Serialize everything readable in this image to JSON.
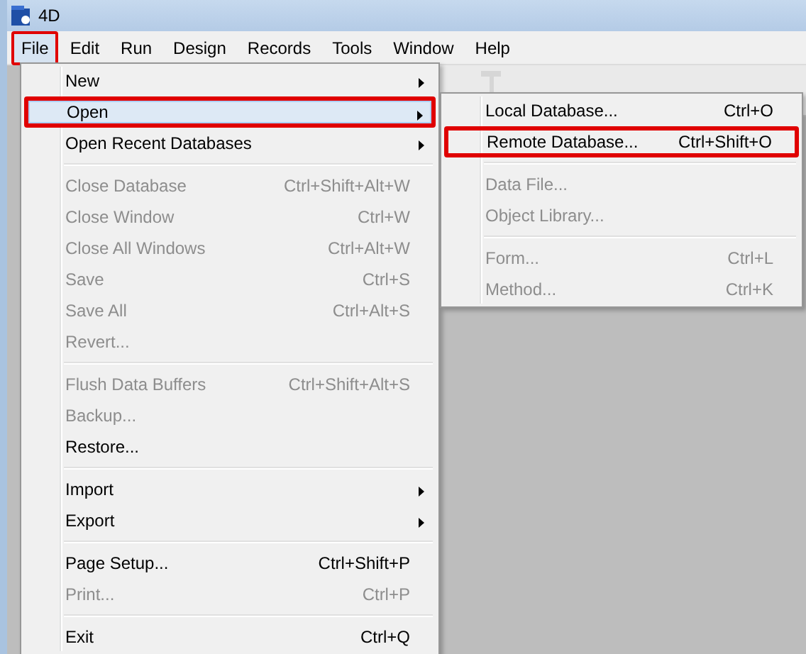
{
  "window": {
    "title": "4D"
  },
  "menubar": [
    {
      "label": "File",
      "selected": true,
      "annotated": true
    },
    {
      "label": "Edit",
      "selected": false,
      "annotated": false
    },
    {
      "label": "Run",
      "selected": false,
      "annotated": false
    },
    {
      "label": "Design",
      "selected": false,
      "annotated": false
    },
    {
      "label": "Records",
      "selected": false,
      "annotated": false
    },
    {
      "label": "Tools",
      "selected": false,
      "annotated": false
    },
    {
      "label": "Window",
      "selected": false,
      "annotated": false
    },
    {
      "label": "Help",
      "selected": false,
      "annotated": false
    }
  ],
  "file_menu": [
    {
      "kind": "item",
      "label": "New",
      "submenu": true,
      "disabled": false,
      "selected": false,
      "annotated": false
    },
    {
      "kind": "item",
      "label": "Open",
      "submenu": true,
      "disabled": false,
      "selected": true,
      "annotated": true
    },
    {
      "kind": "item",
      "label": "Open Recent Databases",
      "submenu": true,
      "disabled": false,
      "selected": false,
      "annotated": false
    },
    {
      "kind": "separator"
    },
    {
      "kind": "item",
      "label": "Close Database",
      "shortcut": "Ctrl+Shift+Alt+W",
      "submenu": false,
      "disabled": true,
      "selected": false,
      "annotated": false
    },
    {
      "kind": "item",
      "label": "Close Window",
      "shortcut": "Ctrl+W",
      "submenu": false,
      "disabled": true,
      "selected": false,
      "annotated": false
    },
    {
      "kind": "item",
      "label": "Close All Windows",
      "shortcut": "Ctrl+Alt+W",
      "submenu": false,
      "disabled": true,
      "selected": false,
      "annotated": false
    },
    {
      "kind": "item",
      "label": "Save",
      "shortcut": "Ctrl+S",
      "submenu": false,
      "disabled": true,
      "selected": false,
      "annotated": false
    },
    {
      "kind": "item",
      "label": "Save All",
      "shortcut": "Ctrl+Alt+S",
      "submenu": false,
      "disabled": true,
      "selected": false,
      "annotated": false
    },
    {
      "kind": "item",
      "label": "Revert...",
      "submenu": false,
      "disabled": true,
      "selected": false,
      "annotated": false
    },
    {
      "kind": "separator"
    },
    {
      "kind": "item",
      "label": "Flush Data Buffers",
      "shortcut": "Ctrl+Shift+Alt+S",
      "submenu": false,
      "disabled": true,
      "selected": false,
      "annotated": false
    },
    {
      "kind": "item",
      "label": "Backup...",
      "submenu": false,
      "disabled": true,
      "selected": false,
      "annotated": false
    },
    {
      "kind": "item",
      "label": "Restore...",
      "submenu": false,
      "disabled": false,
      "selected": false,
      "annotated": false
    },
    {
      "kind": "separator"
    },
    {
      "kind": "item",
      "label": "Import",
      "submenu": true,
      "disabled": false,
      "selected": false,
      "annotated": false
    },
    {
      "kind": "item",
      "label": "Export",
      "submenu": true,
      "disabled": false,
      "selected": false,
      "annotated": false
    },
    {
      "kind": "separator"
    },
    {
      "kind": "item",
      "label": "Page Setup...",
      "shortcut": "Ctrl+Shift+P",
      "submenu": false,
      "disabled": false,
      "selected": false,
      "annotated": false
    },
    {
      "kind": "item",
      "label": "Print...",
      "shortcut": "Ctrl+P",
      "submenu": false,
      "disabled": true,
      "selected": false,
      "annotated": false
    },
    {
      "kind": "separator"
    },
    {
      "kind": "item",
      "label": "Exit",
      "shortcut": "Ctrl+Q",
      "submenu": false,
      "disabled": false,
      "selected": false,
      "annotated": false
    }
  ],
  "open_submenu": [
    {
      "kind": "item",
      "label": "Local Database...",
      "shortcut": "Ctrl+O",
      "submenu": false,
      "disabled": false,
      "selected": false,
      "annotated": false
    },
    {
      "kind": "item",
      "label": "Remote Database...",
      "shortcut": "Ctrl+Shift+O",
      "submenu": false,
      "disabled": false,
      "selected": false,
      "annotated": true
    },
    {
      "kind": "separator"
    },
    {
      "kind": "item",
      "label": "Data File...",
      "submenu": false,
      "disabled": true,
      "selected": false,
      "annotated": false
    },
    {
      "kind": "item",
      "label": "Object Library...",
      "submenu": false,
      "disabled": true,
      "selected": false,
      "annotated": false
    },
    {
      "kind": "separator"
    },
    {
      "kind": "item",
      "label": "Form...",
      "shortcut": "Ctrl+L",
      "submenu": false,
      "disabled": true,
      "selected": false,
      "annotated": false
    },
    {
      "kind": "item",
      "label": "Method...",
      "shortcut": "Ctrl+K",
      "submenu": false,
      "disabled": true,
      "selected": false,
      "annotated": false
    }
  ]
}
